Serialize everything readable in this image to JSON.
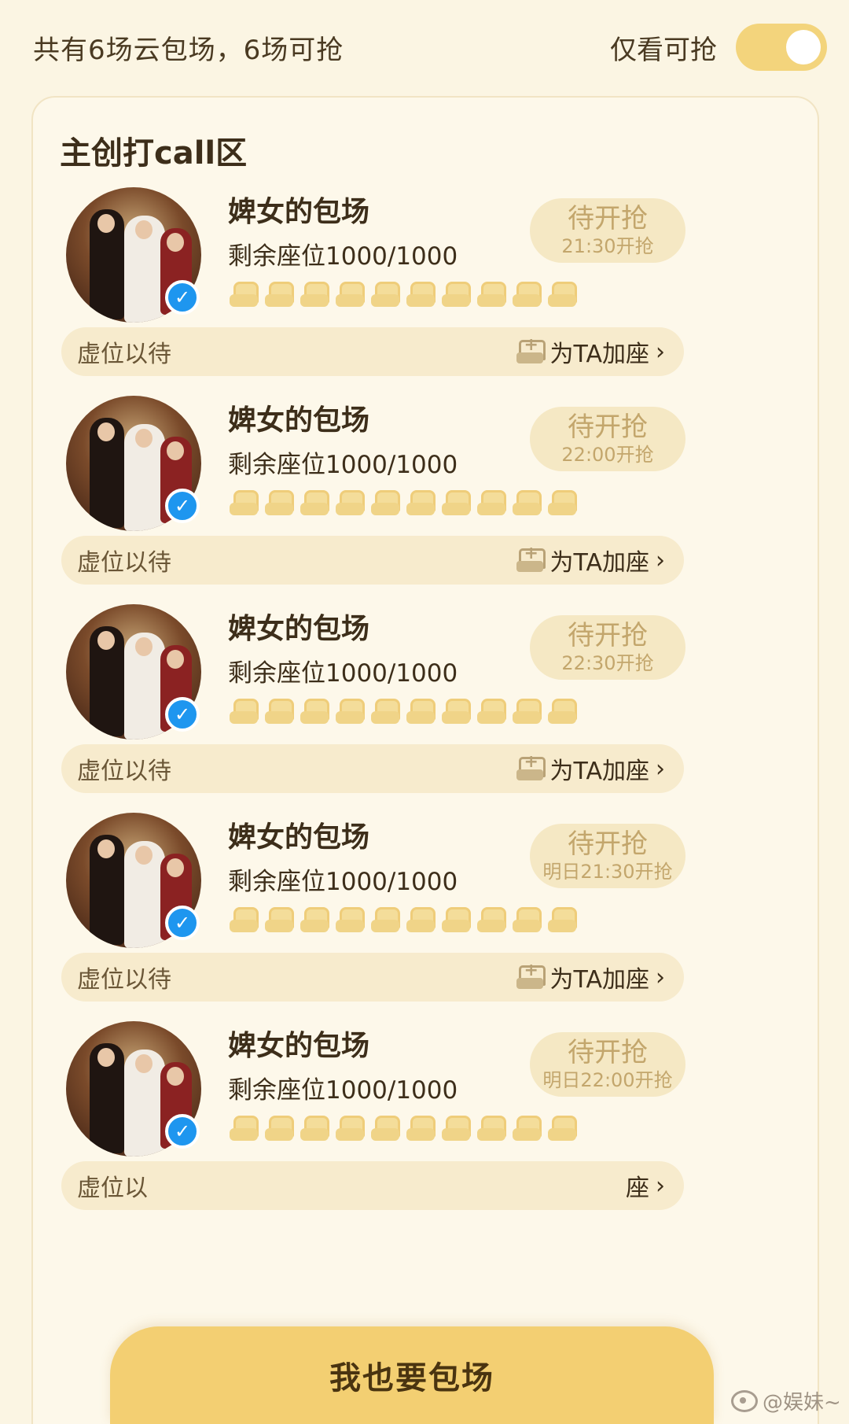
{
  "header": {
    "summary": "共有6场云包场，6场可抢",
    "filter_label": "仅看可抢",
    "filter_on": true
  },
  "section": {
    "title": "主创打call区"
  },
  "entries": [
    {
      "name": "婢女的包场",
      "seats": "剩余座位1000/1000",
      "status": "待开抢",
      "time": "21:30开抢",
      "bar_label": "虚位以待",
      "add_label": "为TA加座",
      "chevron": "›"
    },
    {
      "name": "婢女的包场",
      "seats": "剩余座位1000/1000",
      "status": "待开抢",
      "time": "22:00开抢",
      "bar_label": "虚位以待",
      "add_label": "为TA加座",
      "chevron": "›"
    },
    {
      "name": "婢女的包场",
      "seats": "剩余座位1000/1000",
      "status": "待开抢",
      "time": "22:30开抢",
      "bar_label": "虚位以待",
      "add_label": "为TA加座",
      "chevron": "›"
    },
    {
      "name": "婢女的包场",
      "seats": "剩余座位1000/1000",
      "status": "待开抢",
      "time": "明日21:30开抢",
      "bar_label": "虚位以待",
      "add_label": "为TA加座",
      "chevron": "›"
    },
    {
      "name": "婢女的包场",
      "seats": "剩余座位1000/1000",
      "status": "待开抢",
      "time": "明日22:00开抢",
      "bar_label": "虚位以",
      "add_label": "座",
      "chevron": "›"
    }
  ],
  "cta": {
    "label": "我也要包场"
  },
  "watermark": {
    "text": "@娱妹~"
  },
  "colors": {
    "accent": "#f3cf72",
    "background": "#fbf5e3",
    "verified": "#1e96ef"
  }
}
